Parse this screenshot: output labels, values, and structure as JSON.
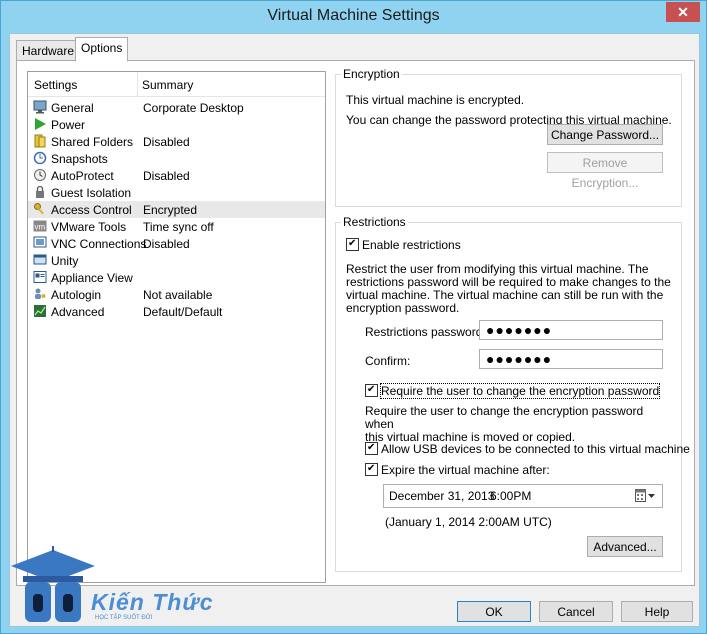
{
  "window": {
    "title": "Virtual Machine Settings",
    "close_icon": "close-icon"
  },
  "tabs": [
    {
      "label": "Hardware",
      "active": false
    },
    {
      "label": "Options",
      "active": true
    }
  ],
  "settings_list": {
    "headers": {
      "settings": "Settings",
      "summary": "Summary"
    },
    "items": [
      {
        "label": "General",
        "summary": "Corporate Desktop",
        "icon": "monitor-icon",
        "selected": false
      },
      {
        "label": "Power",
        "summary": "",
        "icon": "play-icon",
        "selected": false
      },
      {
        "label": "Shared Folders",
        "summary": "Disabled",
        "icon": "folder-icon",
        "selected": false
      },
      {
        "label": "Snapshots",
        "summary": "",
        "icon": "snapshot-icon",
        "selected": false
      },
      {
        "label": "AutoProtect",
        "summary": "Disabled",
        "icon": "clock-icon",
        "selected": false
      },
      {
        "label": "Guest Isolation",
        "summary": "",
        "icon": "lock-icon",
        "selected": false
      },
      {
        "label": "Access Control",
        "summary": "Encrypted",
        "icon": "key-icon",
        "selected": true
      },
      {
        "label": "VMware Tools",
        "summary": "Time sync off",
        "icon": "vm-icon",
        "selected": false
      },
      {
        "label": "VNC Connections",
        "summary": "Disabled",
        "icon": "vnc-icon",
        "selected": false
      },
      {
        "label": "Unity",
        "summary": "",
        "icon": "unity-icon",
        "selected": false
      },
      {
        "label": "Appliance View",
        "summary": "",
        "icon": "appliance-icon",
        "selected": false
      },
      {
        "label": "Autologin",
        "summary": "Not available",
        "icon": "user-key-icon",
        "selected": false
      },
      {
        "label": "Advanced",
        "summary": "Default/Default",
        "icon": "chart-icon",
        "selected": false
      }
    ]
  },
  "encryption": {
    "legend": "Encryption",
    "status_text": "This virtual machine is encrypted.",
    "info_text": "You can change the password protecting this virtual machine.",
    "change_password_button": "Change Password...",
    "remove_encryption_button": "Remove Encryption..."
  },
  "restrictions": {
    "legend": "Restrictions",
    "enable_label": "Enable restrictions",
    "enable_checked": true,
    "description_lines": [
      "Restrict the user from modifying this virtual machine. The",
      "restrictions password will be required to make changes to the",
      "virtual machine. The virtual machine can still be run with the",
      "encryption password."
    ],
    "password_label": "Restrictions password:",
    "password_value": "●●●●●●●",
    "confirm_label": "Confirm:",
    "confirm_value": "●●●●●●●",
    "require_change_label": "Require the user to change the encryption password",
    "require_change_checked": true,
    "require_description_lines": [
      "Require the user to change the encryption password when",
      "this virtual machine is moved or copied."
    ],
    "allow_usb_label": "Allow USB devices to be connected to this virtual machine",
    "allow_usb_checked": true,
    "expire_label": "Expire the virtual machine after:",
    "expire_checked": true,
    "expire_date": "December 31, 2013",
    "expire_time": "6:00PM",
    "utc_text": "(January 1, 2014 2:00AM UTC)",
    "advanced_button": "Advanced..."
  },
  "footer": {
    "ok": "OK",
    "cancel": "Cancel",
    "help": "Help"
  },
  "watermark": {
    "text": "Kiến Thức",
    "subtext": "HỌC TẬP SUỐT ĐỜI"
  },
  "colors": {
    "window_frame": "#8fd3f1",
    "close_button": "#c75050",
    "selected_row": "#e8e8e8"
  }
}
